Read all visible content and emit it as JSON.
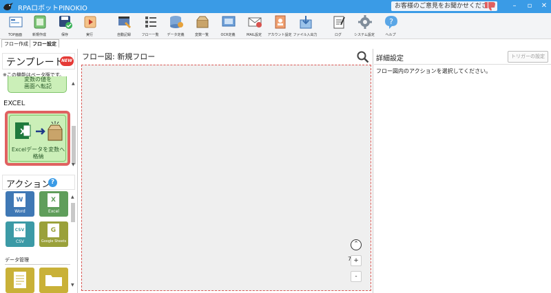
{
  "app": {
    "title": "RPAロボットPINOKIO",
    "feedback": "お客様のご意見をお聞かせください",
    "colors": {
      "titlebar": "#3a9be6",
      "accent_red": "#e06161",
      "template_green": "#cbefb8"
    }
  },
  "window_controls": {
    "minimize": "–",
    "maximize": "▫",
    "close": "✕"
  },
  "toolbar": {
    "items": [
      {
        "label": "TOP画面",
        "icon": "home-icon"
      },
      {
        "label": "新規作成",
        "icon": "new-doc-icon"
      },
      {
        "label": "保存",
        "icon": "save-icon"
      },
      {
        "label": "実行",
        "icon": "play-icon"
      },
      {
        "label": "自動記録",
        "icon": "record-icon"
      },
      {
        "label": "フロー一覧",
        "icon": "list-icon"
      },
      {
        "label": "データ定義",
        "icon": "database-icon"
      },
      {
        "label": "変数一覧",
        "icon": "variable-box-icon"
      },
      {
        "label": "OCR定義",
        "icon": "ocr-icon"
      },
      {
        "label": "MAIL設定",
        "icon": "mail-icon"
      },
      {
        "label": "アカウント設定",
        "icon": "account-icon"
      },
      {
        "label": "ファイル入出力",
        "icon": "file-io-icon"
      },
      {
        "label": "ログ",
        "icon": "log-icon"
      },
      {
        "label": "システム設定",
        "icon": "gear-icon"
      },
      {
        "label": "ヘルプ",
        "icon": "help-icon"
      }
    ]
  },
  "tabs": [
    {
      "label": "フロー作成",
      "active": false
    },
    {
      "label": "フロー設定",
      "active": true
    }
  ],
  "templates": {
    "header": "テンプレート",
    "badge": "NEW",
    "beta_note": "※この機能はベータ版です。",
    "partial_card": {
      "line1": "変数の値を",
      "line2": "画面へ転記"
    },
    "section": "EXCEL",
    "selected_card": {
      "label": "Excelデータを変数へ格納"
    }
  },
  "actions": {
    "header": "アクション",
    "help": "?",
    "items": [
      {
        "label": "Word",
        "glyph": "W",
        "color": "#3f78b5"
      },
      {
        "label": "Excel",
        "glyph": "X",
        "color": "#5f9e5b"
      },
      {
        "label": "CSV",
        "glyph": "CSV",
        "color": "#3c9aa6"
      },
      {
        "label": "Google Sheets",
        "glyph": "G",
        "color": "#9aa13a"
      }
    ],
    "data_section": "データ管理",
    "data_colors": [
      "#c9b138",
      "#c9b138"
    ]
  },
  "flow": {
    "title": "フロー図:  新規フロー",
    "zoom": "75%",
    "zoom_in": "+",
    "zoom_out": "-"
  },
  "detail": {
    "title": "詳細設定",
    "trigger_button": "トリガーの設定",
    "message": "フロー図内のアクションを選択してください。"
  }
}
